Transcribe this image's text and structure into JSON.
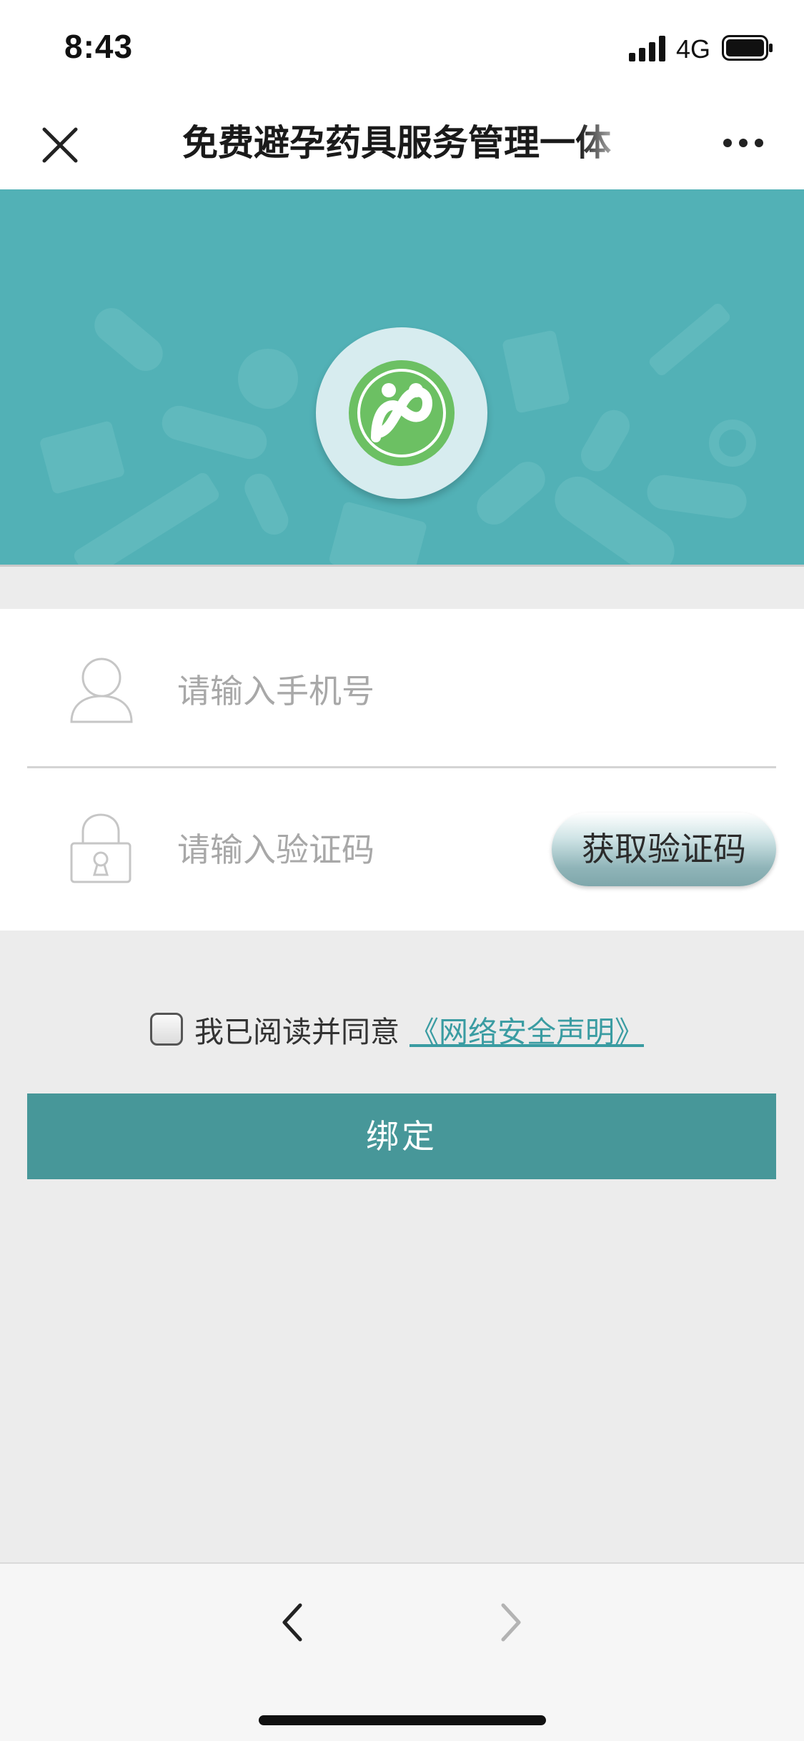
{
  "status_bar": {
    "time": "8:43",
    "network": "4G",
    "icons": [
      "signal-icon",
      "battery-icon"
    ]
  },
  "nav": {
    "title": "免费避孕药具服务管理一体",
    "close_icon": "close-icon",
    "more_icon": "more-icon"
  },
  "banner": {
    "logo_icon": "app-logo",
    "colors": {
      "background": "#52b1b6",
      "logo_green": "#6cc063"
    }
  },
  "form": {
    "phone": {
      "placeholder": "请输入手机号",
      "value": "",
      "icon": "user-icon"
    },
    "code": {
      "placeholder": "请输入验证码",
      "value": "",
      "icon": "lock-icon"
    },
    "get_code_label": "获取验证码"
  },
  "agreement": {
    "checked": false,
    "text": "我已阅读并同意",
    "link_text": "《网络安全声明》"
  },
  "bind_button": {
    "label": "绑定",
    "color": "#479799"
  },
  "bottom_bar": {
    "back_icon": "chevron-left-icon",
    "forward_icon": "chevron-right-icon"
  }
}
